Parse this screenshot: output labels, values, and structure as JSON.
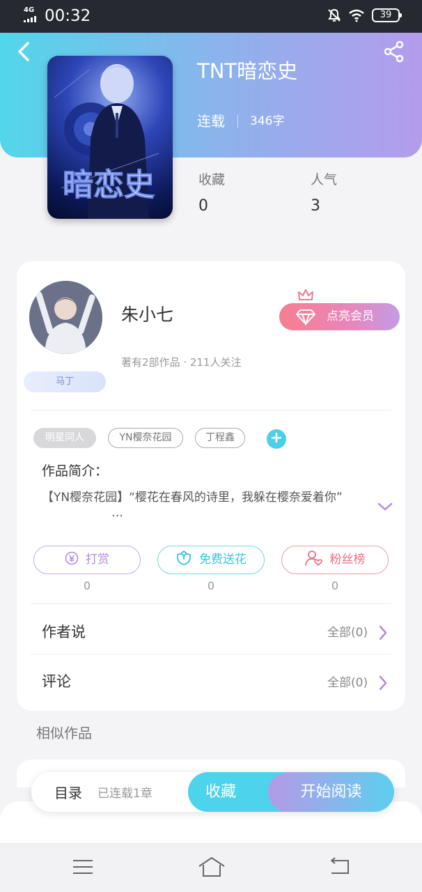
{
  "status_bar": {
    "network": "4G",
    "time": "00:32",
    "battery": "39"
  },
  "book": {
    "title": "TNT暗恋史",
    "status": "连载",
    "word_count": "346字",
    "stats": [
      {
        "label": "收藏",
        "value": "0"
      },
      {
        "label": "人气",
        "value": "3"
      }
    ]
  },
  "author": {
    "name": "朱小七",
    "meta": "著有2部作品 · 211人关注",
    "badge": "马丁",
    "vip_button": "点亮会员"
  },
  "tags": [
    "明星同人",
    "YN樱奈花园",
    "丁程鑫"
  ],
  "intro": {
    "label": "作品简介：",
    "text": "【YN樱奈花园】“樱花在春风的诗里，我躲在樱奈爱着你”",
    "more": "…"
  },
  "actions": [
    {
      "label": "打赏",
      "count": "0",
      "icon": "yen-icon"
    },
    {
      "label": "免费送花",
      "count": "0",
      "icon": "flower-icon"
    },
    {
      "label": "粉丝榜",
      "count": "0",
      "icon": "fan-heart-icon"
    }
  ],
  "rows": [
    {
      "title": "作者说",
      "link": "全部(0)"
    },
    {
      "title": "评论",
      "link": "全部(0)"
    }
  ],
  "similar_title": "相似作品",
  "bottom_bar": {
    "toc": "目录",
    "toc_sub": "已连载1章",
    "favorite": "收藏",
    "read": "开始阅读"
  },
  "colors": {
    "accent_cyan": "#4dd3eb",
    "accent_purple": "#b49ae6",
    "accent_pink": "#ea6f84"
  }
}
